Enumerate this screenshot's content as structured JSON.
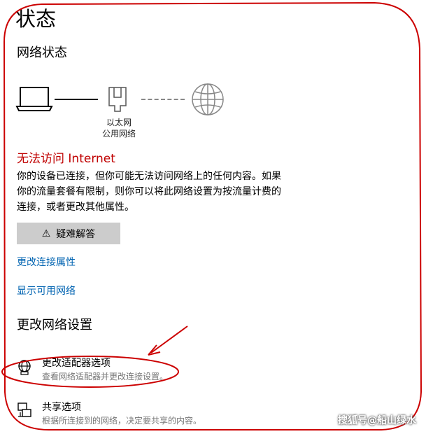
{
  "page": {
    "title": "状态"
  },
  "network_status": {
    "heading": "网络状态",
    "adapter_name": "以太网",
    "network_profile": "公用网络",
    "status_heading": "无法访问 Internet",
    "status_lines": [
      "你的设备已连接，但你可能无法访问网络上的任何内容。如果",
      "你的流量套餐有限制，则你可以将此网络设置为按流量计费的",
      "连接，或者更改其他属性。"
    ],
    "troubleshoot_label": "疑难解答",
    "links": {
      "change_connection_properties": "更改连接属性",
      "show_available_networks": "显示可用网络"
    }
  },
  "change_settings": {
    "heading": "更改网络设置",
    "items": [
      {
        "title": "更改适配器选项",
        "description": "查看网络适配器并更改连接设置。",
        "icon": "adapter-icon"
      },
      {
        "title": "共享选项",
        "description": "根据所连接到的网络，决定要共享的内容。",
        "icon": "sharing-icon"
      }
    ]
  },
  "watermark": "搜狐号@船山绿水",
  "colors": {
    "error": "#c00000",
    "link": "#0063b1",
    "annotation": "#cc0000",
    "button": "#cccccc"
  }
}
